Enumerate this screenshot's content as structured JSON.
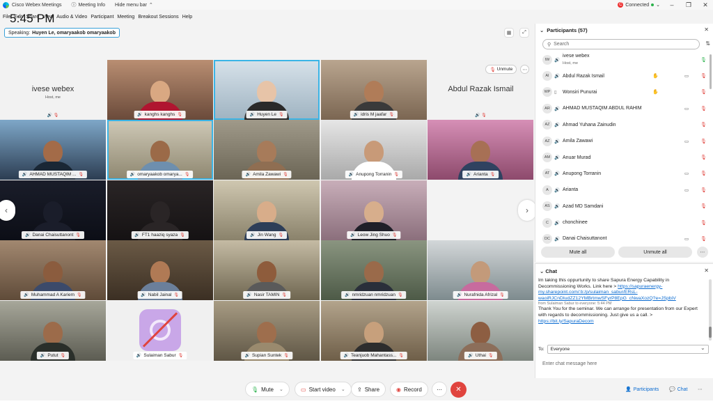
{
  "titlebar": {
    "app_name": "Cisco Webex Meetings",
    "meeting_info": "Meeting Info",
    "hide_menu": "Hide menu bar",
    "connection": "Connected",
    "conn_badge": "C"
  },
  "menu": {
    "items": [
      "File",
      "Edit",
      "Share",
      "View",
      "Audio & Video",
      "Participant",
      "Meeting",
      "Breakout Sessions",
      "Help"
    ]
  },
  "clock": "5:45 PM",
  "speaking": {
    "label": "Speaking:",
    "names": "Huyen Le, omaryaakob omaryaakob"
  },
  "tiles": [
    {
      "name": "ivese webex",
      "sub": "Host, me",
      "avatar": true
    },
    {
      "name": "kanghs kanghs"
    },
    {
      "name": "Huyen Le"
    },
    {
      "name": "idris M jaafar"
    },
    {
      "name": "Abdul Razak Ismail",
      "avatar": true,
      "unmute": "Unmute"
    },
    {
      "name": "AHMAD MUSTAQIM ..."
    },
    {
      "name": "omaryaakob omarya..."
    },
    {
      "name": "Amila Zawawi"
    },
    {
      "name": "Anupong Torranin"
    },
    {
      "name": "Arianta"
    },
    {
      "name": "Danai Chaisuttanont"
    },
    {
      "name": "FT1 haaziq syaza"
    },
    {
      "name": "Jin Wang"
    },
    {
      "name": "Leow Jing Shuo"
    },
    {
      "name": ""
    },
    {
      "name": "Muhammad A Kariem"
    },
    {
      "name": "Nabil Jainal"
    },
    {
      "name": "Nasir TAMIN"
    },
    {
      "name": "nmridzuan nmridzuan"
    },
    {
      "name": "Nurafnida Afrizal"
    },
    {
      "name": "Putut"
    },
    {
      "name": "Sulaiman Sabur"
    },
    {
      "name": "Supian Suntek"
    },
    {
      "name": "Teanjuob Mahantass..."
    },
    {
      "name": "Uthai"
    }
  ],
  "participants": {
    "title": "Participants (57)",
    "search_placeholder": "Search",
    "list": [
      {
        "initials": "IW",
        "name": "ivese webex",
        "role": "Host, me",
        "mic": "on"
      },
      {
        "initials": "AI",
        "name": "Abdul Razak Ismail",
        "hand": true,
        "cam": true
      },
      {
        "initials": "WP",
        "name": "Wonsiri Punurai",
        "hand": true
      },
      {
        "initials": "AR",
        "name": "AHMAD MUSTAQIM ABDUL RAHIM",
        "cam": true
      },
      {
        "initials": "AZ",
        "name": "Ahmad Yuhana Zainudin"
      },
      {
        "initials": "AZ",
        "name": "Amila Zawawi",
        "cam": true
      },
      {
        "initials": "AM",
        "name": "Anuar Murad"
      },
      {
        "initials": "AT",
        "name": "Anupong Torranin",
        "cam": true
      },
      {
        "initials": "A",
        "name": "Arianta",
        "cam": true
      },
      {
        "initials": "AS",
        "name": "Azad MD Samdani"
      },
      {
        "initials": "C",
        "name": "chonchinee"
      },
      {
        "initials": "DC",
        "name": "Danai Chaisuttanont",
        "cam": true
      }
    ],
    "mute_all": "Mute all",
    "unmute_all": "Unmute all"
  },
  "chat": {
    "title": "Chat",
    "msg1": "Im taking this oppurtunity to share Sapura Energy Capability in Decommissioning Works.  Link here > ",
    "link1": "https://sapuraenergy-my.sharepoint.com/:b:/p/sulaiman_sabur/ERsL-waoiRJCnDIudZZ12YMBrtmwSFyrP8EpG_cNwaXozQ?e=JSpbiV",
    "from2": "from Sulaiman Sabur to everyone:    5:44 PM",
    "msg2": "Thank You for the seminar. We can arrange for presentation from our Expert with regards to decommissioning.  Just give us a call. > ",
    "link2": "https://bit.ly/SapuraDecom",
    "to_label": "To:",
    "to_value": "Everyone",
    "input_placeholder": "Enter chat message here"
  },
  "controls": {
    "mute": "Mute",
    "start_video": "Start video",
    "share": "Share",
    "record": "Record",
    "participants": "Participants",
    "chat": "Chat"
  }
}
